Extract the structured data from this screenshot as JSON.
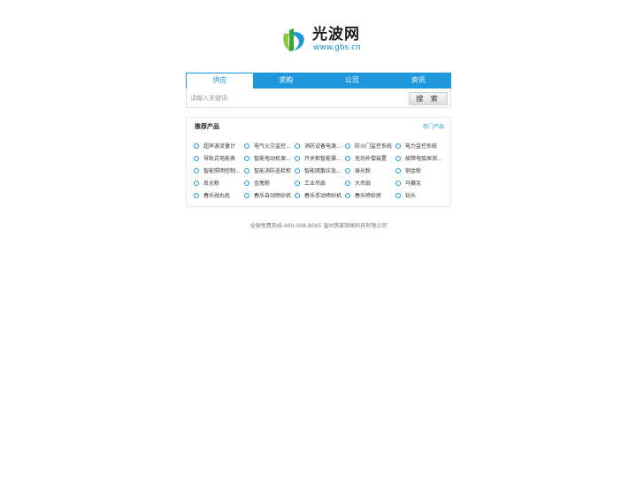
{
  "logo": {
    "name": "光波网",
    "url": "www.gbs.cn"
  },
  "tabs": [
    {
      "label": "供应"
    },
    {
      "label": "求购"
    },
    {
      "label": "公司"
    },
    {
      "label": "资讯"
    }
  ],
  "search": {
    "placeholder": "请输入关键词",
    "button_label": "搜 索"
  },
  "recommend": {
    "title": "推荐产品",
    "hot_link": "热门产品",
    "items": [
      [
        "超声波流量计",
        "电气火灾监控...",
        "消防设备电源...",
        "防火门监控系统",
        "电力监控系统"
      ],
      [
        "导轨式电能表",
        "智能电动机保...",
        "开关柜智能操...",
        "无功补偿装置",
        "故障电弧探测..."
      ],
      [
        "智能照明控制...",
        "智能消防巡检柜",
        "智能疏散应急...",
        "珠光粉",
        "铜金粉"
      ],
      [
        "反光粉",
        "金葱粉",
        "工业吊扇",
        "大吊扇",
        "马赛克"
      ],
      [
        "春乐抛丸机",
        "春乐自动喷砂机",
        "春乐手动喷砂机",
        "春乐喷砂房",
        "钻头"
      ]
    ]
  },
  "footer": {
    "text": "全国免费热线:400-008-8065 温州筑家网络科技有限公司"
  }
}
